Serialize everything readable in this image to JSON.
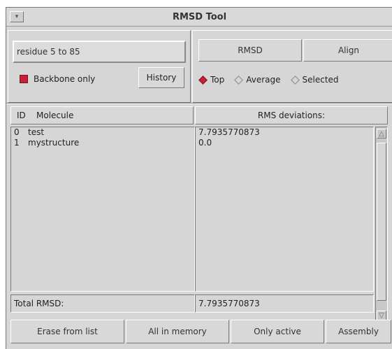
{
  "window": {
    "title": "RMSD Tool",
    "menu_glyph": "▾"
  },
  "selection": {
    "value": "residue 5 to 85"
  },
  "backbone": {
    "label": "Backbone only",
    "checked": true
  },
  "history": {
    "label": "History"
  },
  "toolbar": {
    "rmsd_label": "RMSD",
    "align_label": "Align"
  },
  "reference": {
    "options": [
      {
        "label": "Top",
        "selected": true
      },
      {
        "label": "Average",
        "selected": false
      },
      {
        "label": "Selected",
        "selected": false
      }
    ]
  },
  "table": {
    "id_header": "ID",
    "molecule_header": "Molecule",
    "rms_header": "RMS deviations:",
    "rows": [
      {
        "id": "0",
        "molecule": "test",
        "rms": "7.7935770873"
      },
      {
        "id": "1",
        "molecule": "mystructure",
        "rms": "0.0"
      }
    ],
    "total_label": "Total RMSD:",
    "total_value": "7.7935770873"
  },
  "bottom": {
    "erase_label": "Erase from list",
    "all_label": "All in memory",
    "active_label": "Only active",
    "assembly_label": "Assembly"
  },
  "colors": {
    "checkbox": "#c8203a",
    "background": "#d6d6d6"
  }
}
